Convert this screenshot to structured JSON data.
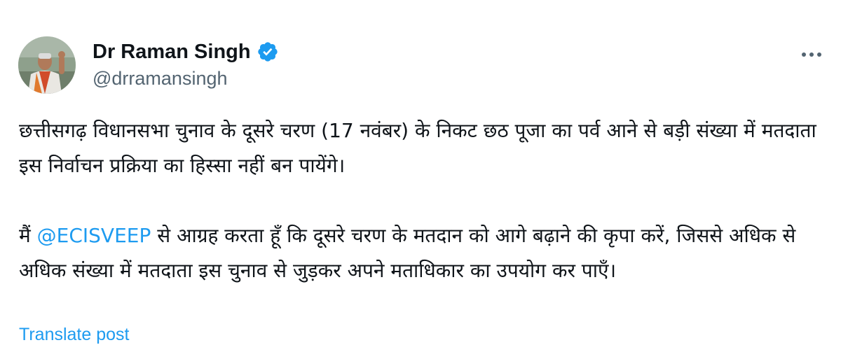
{
  "author": {
    "display_name": "Dr Raman Singh",
    "handle": "@drramansingh",
    "verified": true,
    "verified_icon": "verified-badge-icon",
    "avatar_icon": "profile-photo"
  },
  "more_icon": "more-options-icon",
  "post": {
    "paragraph1": "छत्तीसगढ़ विधानसभा चुनाव के दूसरे चरण (17 नवंबर) के निकट छठ पूजा का पर्व आने से बड़ी संख्या में मतदाता इस निर्वाचन प्रक्रिया का हिस्सा नहीं बन पायेंगे।",
    "paragraph2_prefix": "मैं ",
    "paragraph2_mention": "@ECISVEEP",
    "paragraph2_suffix": " से आग्रह करता हूँ कि दूसरे चरण के मतदान को आगे बढ़ाने की कृपा करें, जिससे अधिक से अधिक संख्या में मतदाता इस चुनाव से जुड़कर अपने मताधिकार का उपयोग कर पाएँ।"
  },
  "translate_label": "Translate post",
  "colors": {
    "text": "#0f1419",
    "secondary": "#536471",
    "link": "#1d9bf0"
  }
}
